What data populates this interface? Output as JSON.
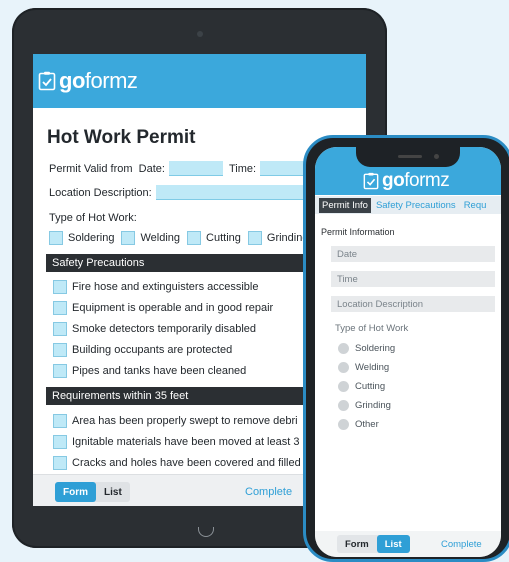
{
  "brand": {
    "go": "go",
    "formz": "formz"
  },
  "tablet": {
    "title": "Hot Work Permit",
    "permit_valid_from": "Permit Valid from",
    "date_label": "Date:",
    "time_label": "Time:",
    "location_label": "Location Description:",
    "type_label": "Type of Hot Work:",
    "work_types": [
      "Soldering",
      "Welding",
      "Cutting",
      "Grinding"
    ],
    "section_safety": "Safety Precautions",
    "safety_items": [
      "Fire hose and extinguisters accessible",
      "Equipment is operable and in good repair",
      "Smoke detectors temporarily disabled",
      "Building occupants are protected",
      "Pipes and tanks have been cleaned"
    ],
    "section_requirements": "Requirements within 35 feet",
    "requirement_items": [
      "Area has been properly swept to remove debri",
      "Ignitable materials have been moved at least 3",
      "Cracks and holes have been covered and filled"
    ],
    "footer": {
      "form": "Form",
      "list": "List",
      "complete": "Complete"
    }
  },
  "phone": {
    "tabs": [
      "Permit Info",
      "Safety Precautions",
      "Requ"
    ],
    "section_label": "Permit Information",
    "inputs": [
      "Date",
      "Time",
      "Location Description"
    ],
    "type_label": "Type of Hot Work",
    "options": [
      "Soldering",
      "Welding",
      "Cutting",
      "Grinding",
      "Other"
    ],
    "footer": {
      "form": "Form",
      "list": "List",
      "complete": "Complete"
    }
  },
  "colors": {
    "brand_blue": "#3ba8dc",
    "field_blue": "#bfe9f7",
    "dark": "#2b2f33",
    "phone_frame": "#2b8cc4"
  }
}
